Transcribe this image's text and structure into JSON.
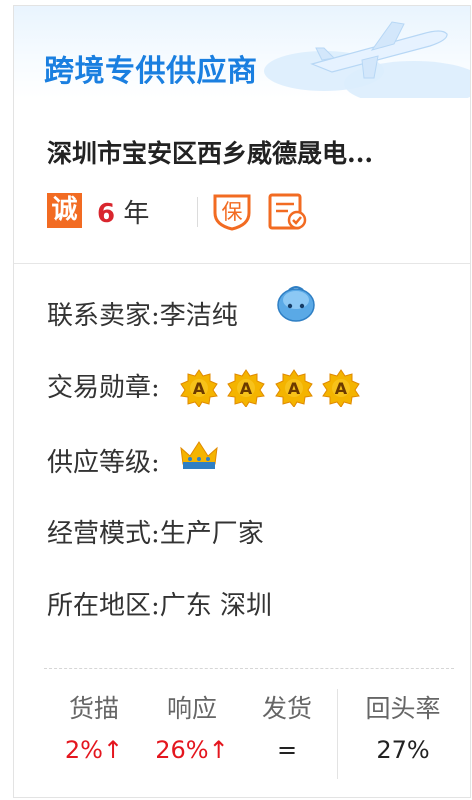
{
  "banner": {
    "title": "跨境专供供应商"
  },
  "company": {
    "name": "深圳市宝安区西乡威德晟电..."
  },
  "badges": {
    "cheng_icon": "诚",
    "years_num": "6",
    "years_unit": "年",
    "bao_icon": "保",
    "icons": [
      "cheng-badge-icon",
      "guarantee-shield-icon",
      "certificate-document-icon"
    ],
    "brand_color": "#f26b22"
  },
  "info": {
    "contact": {
      "label": "联系卖家:",
      "value": "李洁纯"
    },
    "medals": {
      "label": "交易勋章:",
      "medal_letter": "A",
      "count": 4
    },
    "level": {
      "label": "供应等级:"
    },
    "mode": {
      "label": "经营模式:",
      "value": "生产厂家"
    },
    "region": {
      "label": "所在地区:",
      "value": "广东 深圳"
    }
  },
  "stats": [
    {
      "label": "货描",
      "value": "2%↑",
      "color": "#e4161e"
    },
    {
      "label": "响应",
      "value": "26%↑",
      "color": "#e4161e"
    },
    {
      "label": "发货",
      "value": "=",
      "color": "#222222"
    },
    {
      "label": "回头率",
      "value": "27%",
      "color": "#222222"
    }
  ]
}
